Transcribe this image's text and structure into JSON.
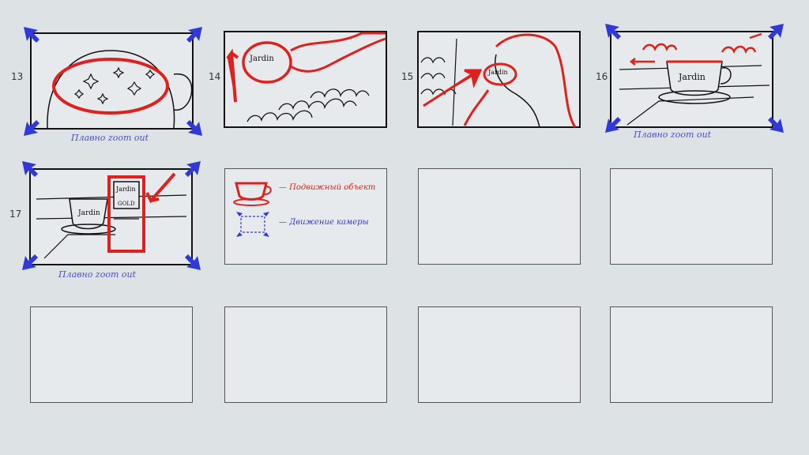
{
  "colors": {
    "ink": "#111111",
    "object": "#e0201c",
    "camera": "#3038d8",
    "paper": "#dde3e5"
  },
  "frames": [
    {
      "number": "13",
      "caption": "Плавно zoom out",
      "cup_label": ""
    },
    {
      "number": "14",
      "caption": "",
      "cup_label": "Jardin"
    },
    {
      "number": "15",
      "caption": "",
      "cup_label": "Jardin"
    },
    {
      "number": "16",
      "caption": "Плавно zoom out",
      "cup_label": "Jardin"
    },
    {
      "number": "17",
      "caption": "Плавно zoom out",
      "cup_label": "Jardin",
      "pack_label_1": "Jardin",
      "pack_label_2": "GOLD"
    }
  ],
  "legend": {
    "object_label": "— Подвижный объект",
    "camera_label": "— Движение камеры"
  }
}
